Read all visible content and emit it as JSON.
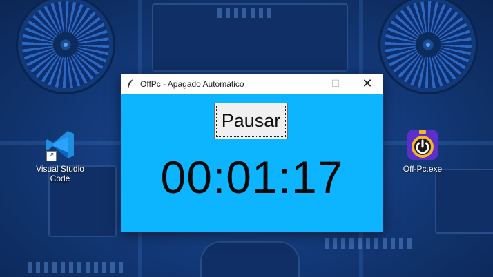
{
  "desktop": {
    "icons": [
      {
        "label": "Visual Studio Code",
        "icon": "vscode-icon",
        "shortcut": true
      },
      {
        "label": "Off-Pc.exe",
        "icon": "power-timer-icon",
        "shortcut": false
      }
    ]
  },
  "window": {
    "title": "OffPc - Apagado Automático",
    "icon": "feather-icon",
    "controls": {
      "minimize": "minimize-icon",
      "maximize": "maximize-icon",
      "close": "close-icon"
    },
    "background_color": "#0db4ff",
    "pause_label": "Pausar",
    "timer": "00:01:17"
  },
  "colors": {
    "desktop_background": "#143b7c",
    "app_background": "#0db4ff"
  }
}
